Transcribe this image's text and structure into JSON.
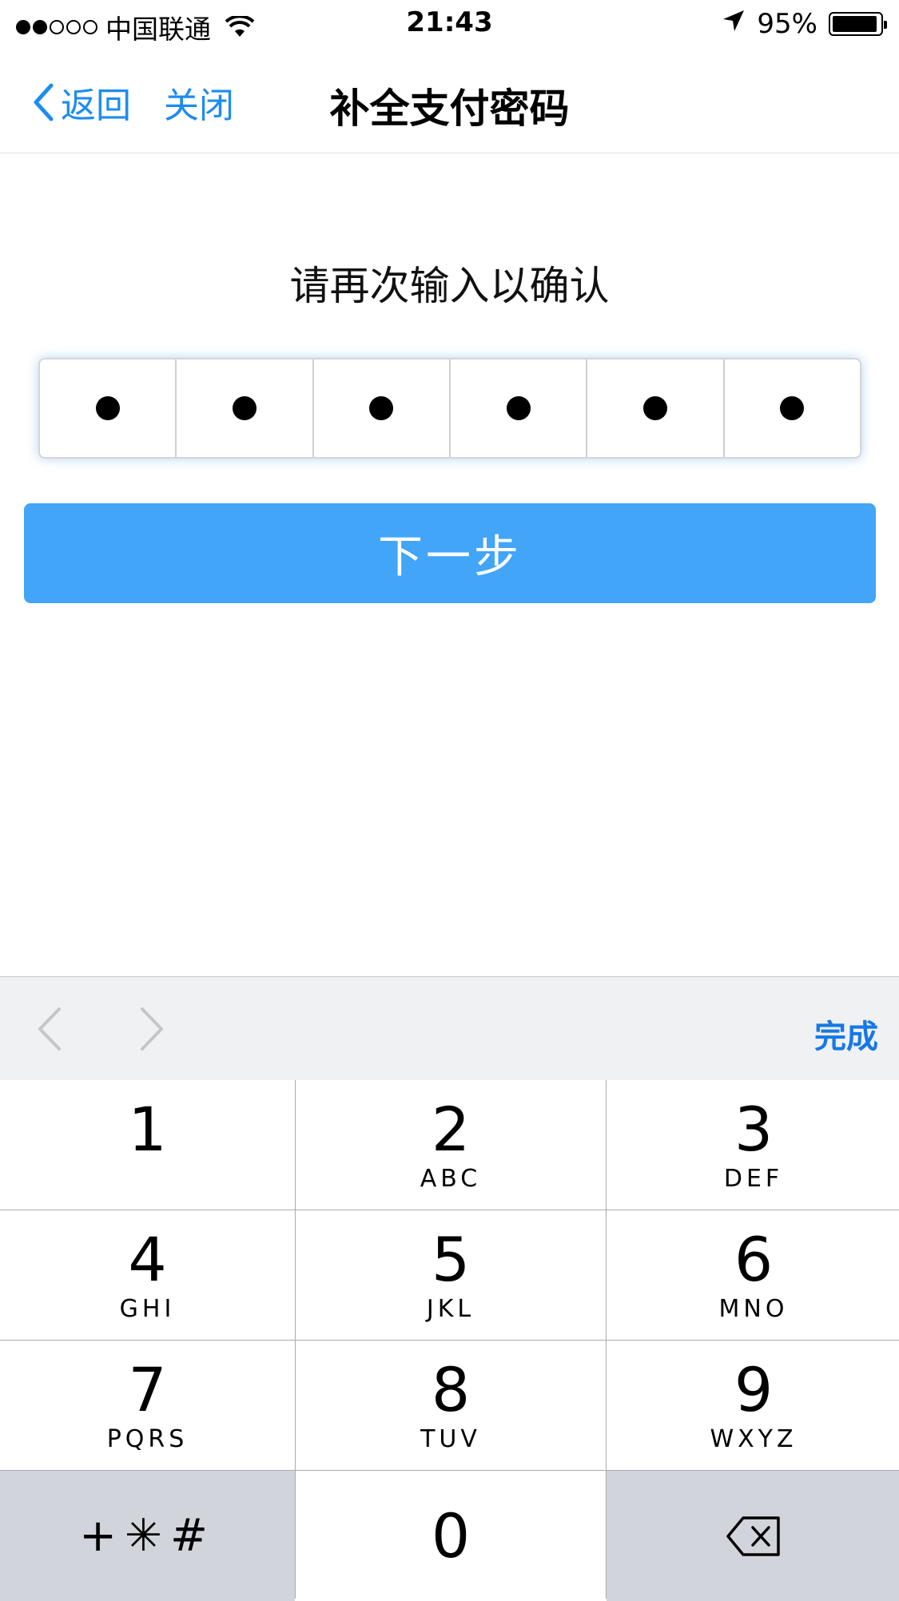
{
  "status_bar": {
    "carrier": "中国联通",
    "time": "21:43",
    "battery_text": "95%",
    "battery_level": 0.95,
    "signal_bars_filled": 2,
    "signal_bars_total": 5
  },
  "nav": {
    "back_label": "返回",
    "close_label": "关闭",
    "title": "补全支付密码"
  },
  "content": {
    "prompt": "请再次输入以确认",
    "pin_length": 6,
    "pin_filled": 6,
    "next_label": "下一步"
  },
  "keyboard_toolbar": {
    "done_label": "完成"
  },
  "keypad": {
    "keys": [
      {
        "num": "1",
        "letters": ""
      },
      {
        "num": "2",
        "letters": "ABC"
      },
      {
        "num": "3",
        "letters": "DEF"
      },
      {
        "num": "4",
        "letters": "GHI"
      },
      {
        "num": "5",
        "letters": "JKL"
      },
      {
        "num": "6",
        "letters": "MNO"
      },
      {
        "num": "7",
        "letters": "PQRS"
      },
      {
        "num": "8",
        "letters": "TUV"
      },
      {
        "num": "9",
        "letters": "WXYZ"
      }
    ],
    "symbols_label": "+✳#",
    "zero": "0"
  },
  "colors": {
    "accent": "#1d8cf0",
    "button": "#42a5f8",
    "done": "#1678e6"
  }
}
